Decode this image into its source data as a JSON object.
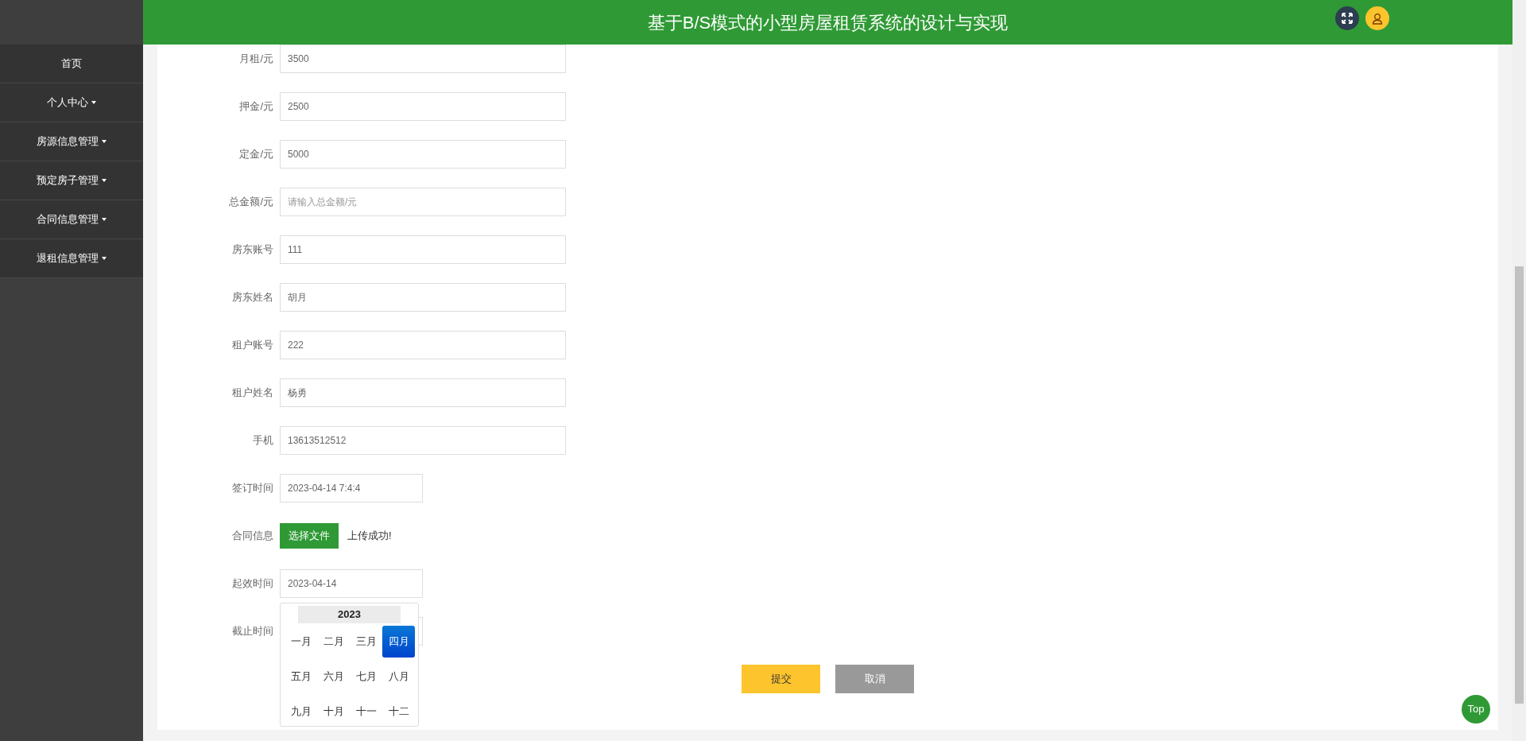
{
  "header": {
    "title": "基于B/S模式的小型房屋租赁系统的设计与实现"
  },
  "sidebar": {
    "items": [
      {
        "label": "首页",
        "kind": "link"
      },
      {
        "label": "个人中心",
        "kind": "dropdown"
      },
      {
        "label": "房源信息管理",
        "kind": "dropdown"
      },
      {
        "label": "预定房子管理",
        "kind": "dropdown"
      },
      {
        "label": "合同信息管理",
        "kind": "dropdown"
      },
      {
        "label": "退租信息管理",
        "kind": "dropdown"
      }
    ]
  },
  "form": {
    "fields": [
      {
        "label": "月租/元",
        "kind": "text",
        "value": "3500"
      },
      {
        "label": "押金/元",
        "kind": "text",
        "value": "2500"
      },
      {
        "label": "定金/元",
        "kind": "text",
        "value": "5000"
      },
      {
        "label": "总金额/元",
        "kind": "text",
        "placeholder": "请输入总金额/元"
      },
      {
        "label": "房东账号",
        "kind": "text",
        "value": "111"
      },
      {
        "label": "房东姓名",
        "kind": "text",
        "value": "胡月"
      },
      {
        "label": "租户账号",
        "kind": "text",
        "value": "222"
      },
      {
        "label": "租户姓名",
        "kind": "text",
        "value": "杨勇"
      },
      {
        "label": "手机",
        "kind": "text",
        "value": "13613512512"
      },
      {
        "label": "签订时间",
        "kind": "date",
        "value": "2023-04-14 7:4:4"
      },
      {
        "label": "合同信息",
        "kind": "file",
        "button": "选择文件",
        "status": "上传成功!"
      },
      {
        "label": "起效时间",
        "kind": "date",
        "value": "2023-04-14"
      },
      {
        "label": "截止时间",
        "kind": "date",
        "picker_open": true
      }
    ],
    "buttons": [
      {
        "label": "提交",
        "kind": "primary"
      },
      {
        "label": "取消",
        "kind": "secondary"
      }
    ]
  },
  "month_picker": {
    "year": "2023",
    "months": [
      {
        "label": "一月",
        "selected": false
      },
      {
        "label": "二月",
        "selected": false
      },
      {
        "label": "三月",
        "selected": false
      },
      {
        "label": "四月",
        "selected": true
      },
      {
        "label": "五月",
        "selected": false
      },
      {
        "label": "六月",
        "selected": false
      },
      {
        "label": "七月",
        "selected": false
      },
      {
        "label": "八月",
        "selected": false
      },
      {
        "label": "九月",
        "selected": false
      },
      {
        "label": "十月",
        "selected": false
      },
      {
        "label": "十一",
        "selected": false
      },
      {
        "label": "十二",
        "selected": false
      }
    ]
  },
  "back_to_top": {
    "label": "Top"
  }
}
